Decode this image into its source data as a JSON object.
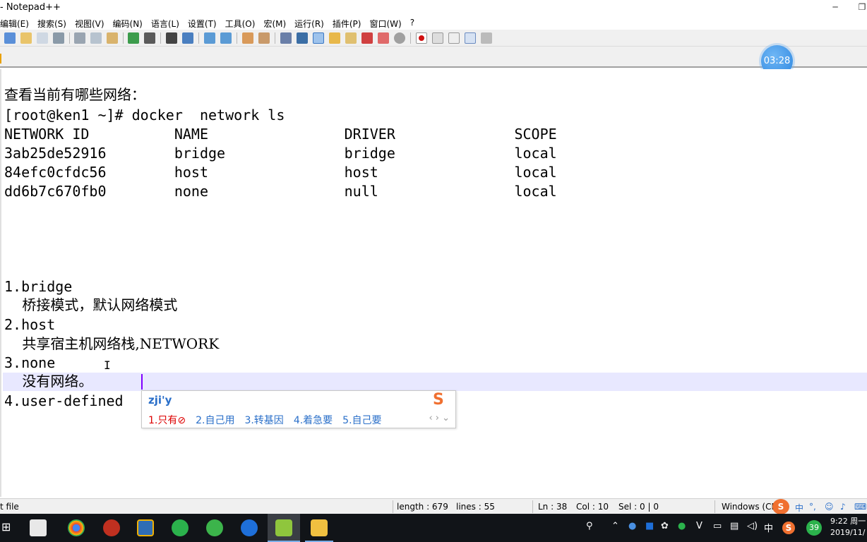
{
  "window": {
    "title": "- Notepad++",
    "min_label": "─",
    "restore_label": "❐"
  },
  "menu": [
    "编辑(E)",
    "搜索(S)",
    "视图(V)",
    "编码(N)",
    "语言(L)",
    "设置(T)",
    "工具(O)",
    "宏(M)",
    "运行(R)",
    "插件(P)",
    "窗口(W)",
    "?"
  ],
  "timer": "03:28",
  "editor": {
    "lines": [
      "查看当前有哪些网络：",
      "[root@ken1 ~]# docker  network ls",
      "NETWORK ID          NAME                DRIVER              SCOPE",
      "3ab25de52916        bridge              bridge              local",
      "84efc0cfdc56        host                host                local",
      "dd6b7c670fb0        none                null                local",
      "1.bridge",
      "    桥接模式，默认网络模式",
      "2.host",
      "    共享宿主机网络栈,NETWORK",
      "3.none",
      "    没有网络。",
      "4.user-defined"
    ]
  },
  "ime": {
    "composition": "zji'y",
    "candidates": [
      "1.只有⊘",
      "2.自己用",
      "3.转基因",
      "4.着急要",
      "5.自己要"
    ],
    "nav": "‹ › ⌄",
    "logo": "S"
  },
  "statusbar": {
    "filetype": "t file",
    "length": "length : 679",
    "lines": "lines : 55",
    "ln": "Ln : 38",
    "col": "Col : 10",
    "sel": "Sel : 0 | 0",
    "eol": "Windows (CR"
  },
  "tray": {
    "ime_lang": "中",
    "tray_lang": "中",
    "badge": "39",
    "time": "9:22 周一",
    "date": "2019/11/"
  },
  "colors": {
    "current_line": "#e8e8ff",
    "caret": "#8000ff",
    "ime_text": "#2a6fc9",
    "taskbar": "#111418",
    "timer": "#2d86e0"
  }
}
